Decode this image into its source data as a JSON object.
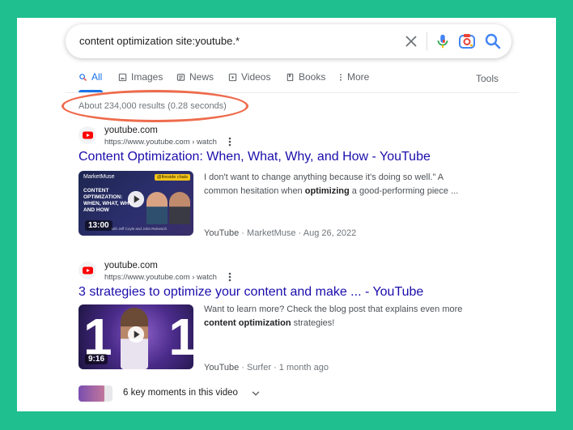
{
  "search": {
    "query": "content optimization site:youtube.*"
  },
  "tabs": [
    {
      "label": "All",
      "icon": "search-icon",
      "active": true
    },
    {
      "label": "Images",
      "icon": "image-icon"
    },
    {
      "label": "News",
      "icon": "news-icon"
    },
    {
      "label": "Videos",
      "icon": "video-icon"
    },
    {
      "label": "Books",
      "icon": "book-icon"
    },
    {
      "label": "More",
      "icon": "more-dots-icon"
    }
  ],
  "tools_label": "Tools",
  "result_stats": "About 234,000 results (0.28 seconds)",
  "results": [
    {
      "site": "youtube.com",
      "url": "https://www.youtube.com › watch",
      "title": "Content Optimization: When, What, Why, and How - YouTube",
      "snippet_parts": [
        "I don't want to change anything because it's doing so well.\" A common hesitation when ",
        "optimizing",
        " a good-performing piece ..."
      ],
      "source": "YouTube",
      "channel": "MarketMuse",
      "date": "Aug 26, 2022",
      "thumbnail": {
        "brand": "MarketMuse",
        "badge": "@fireside chats",
        "headline": "CONTENT OPTIMIZATION: WHEN, WHAT, WHY, AND HOW",
        "byline": "with Jeff Coyle and John Reinesch",
        "duration": "13:00"
      }
    },
    {
      "site": "youtube.com",
      "url": "https://www.youtube.com › watch",
      "title": "3 strategies to optimize your content and make ... - YouTube",
      "snippet_parts": [
        "Want to learn more? Check the blog post that explains even more ",
        "content optimization",
        " strategies!"
      ],
      "source": "YouTube",
      "channel": "Surfer",
      "date": "1 month ago",
      "thumbnail": {
        "big_text": "1 1",
        "duration": "9:16"
      }
    }
  ],
  "key_moments_label": "6 key moments in this video",
  "colors": {
    "background": "#1fbf8f",
    "link": "#1a0dab",
    "accent": "#1a73e8",
    "highlight": "#ee6c4d",
    "youtube_red": "#ff0000"
  }
}
